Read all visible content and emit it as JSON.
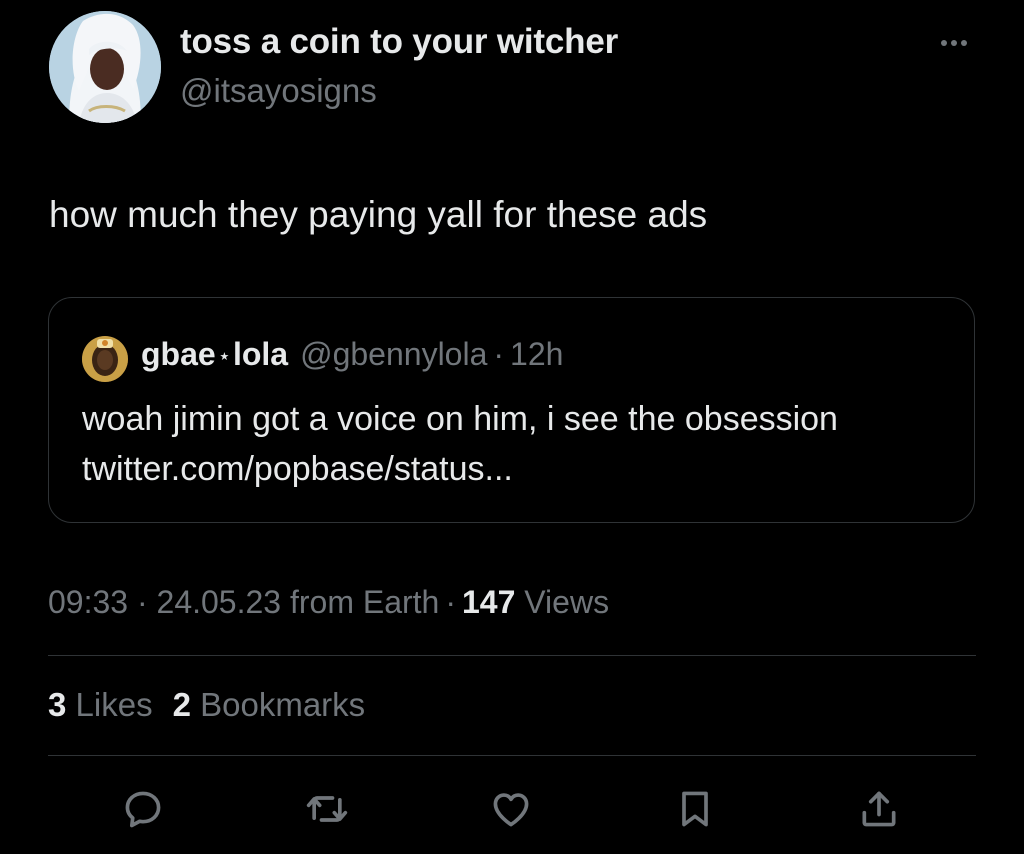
{
  "author": {
    "display_name": "toss a coin to your witcher",
    "handle": "@itsayosigns"
  },
  "tweet": {
    "text": "how much they paying yall for these ads"
  },
  "quoted_tweet": {
    "name_part1": "gbae",
    "name_star": "⋆",
    "name_part2": "lola",
    "handle": "@gbennylola",
    "separator": "·",
    "time": "12h",
    "text_line1": "woah jimin got a voice on him, i see the obsession",
    "text_line2": "twitter.com/popbase/status..."
  },
  "meta": {
    "time": "09:33",
    "sep1": "·",
    "date": "24.05.23",
    "source": "from Earth",
    "sep2": "·",
    "views_count": "147",
    "views_label": "Views"
  },
  "stats": {
    "likes_count": "3",
    "likes_label": "Likes",
    "bookmarks_count": "2",
    "bookmarks_label": "Bookmarks"
  },
  "icons": {
    "reply": "reply-icon",
    "retweet": "retweet-icon",
    "like": "heart-icon",
    "bookmark": "bookmark-icon",
    "share": "share-icon",
    "more": "more-icon"
  },
  "colors": {
    "background": "#000000",
    "primary_text": "#e7e9ea",
    "secondary_text": "#71767b",
    "border": "#2f3336"
  }
}
